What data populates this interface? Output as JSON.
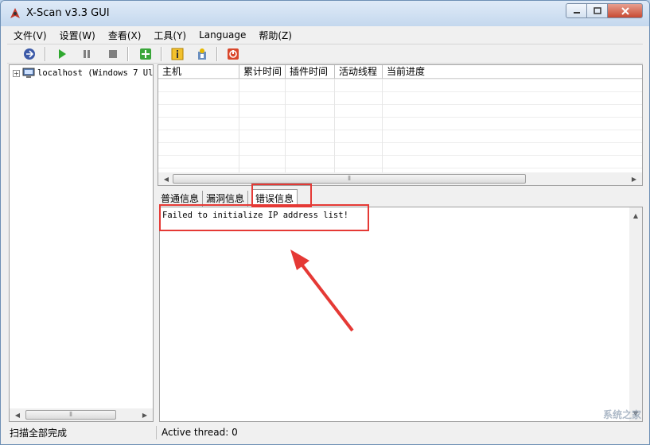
{
  "window": {
    "title": "X-Scan v3.3 GUI"
  },
  "menu": [
    "文件(V)",
    "设置(W)",
    "查看(X)",
    "工具(Y)",
    "Language",
    "帮助(Z)"
  ],
  "toolbar": {
    "icons": [
      "connect-icon",
      "play-icon",
      "pause-icon",
      "stop-icon",
      "plugin-icon",
      "info-icon",
      "wizard-icon",
      "exit-icon"
    ]
  },
  "tree": {
    "expander": "+",
    "root_label": "localhost (Windows 7 Ul"
  },
  "list": {
    "columns": [
      "主机",
      "累计时间",
      "插件时间",
      "活动线程",
      "当前进度"
    ]
  },
  "tabs": [
    "普通信息",
    "漏洞信息",
    "错误信息"
  ],
  "active_tab": "错误信息",
  "log": {
    "lines": [
      "Failed to initialize IP address list!"
    ]
  },
  "status": {
    "left": "扫描全部完成",
    "right": "Active thread: 0"
  },
  "watermark": "系统之家",
  "colors": {
    "highlight": "#e53935"
  }
}
